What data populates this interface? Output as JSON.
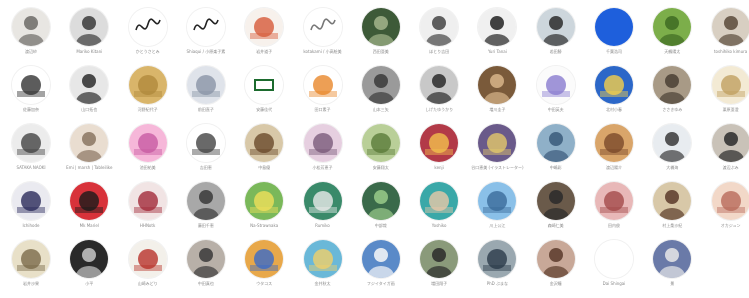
{
  "members": [
    {
      "name": "渡辺紗",
      "fill": "#e8e6e2",
      "accent": "#6c6a66",
      "icon": "portrait-icon"
    },
    {
      "name": "Mariko Kitani",
      "fill": "#dcdcdc",
      "accent": "#3a3a3a",
      "icon": "portrait-icon"
    },
    {
      "name": "かとうさとみ",
      "fill": "#ffffff",
      "accent": "#222222",
      "icon": "signature-icon"
    },
    {
      "name": "Shiaqui / 小原楽子素",
      "fill": "#ffffff",
      "accent": "#222222",
      "icon": "signature-icon"
    },
    {
      "name": "岩井道子",
      "fill": "#f7f1ec",
      "accent": "#d65a3a",
      "icon": "illustration-icon"
    },
    {
      "name": "kotakami / 小高絵美",
      "fill": "#ffffff",
      "accent": "#777777",
      "icon": "signature-icon"
    },
    {
      "name": "西田亜美",
      "fill": "#3d5a38",
      "accent": "#a3b58c",
      "icon": "photo-icon"
    },
    {
      "name": "ほとり吉田",
      "fill": "#efefef",
      "accent": "#444444",
      "icon": "portrait-icon"
    },
    {
      "name": "Yuri Tanai",
      "fill": "#f0f0f0",
      "accent": "#222222",
      "icon": "portrait-icon"
    },
    {
      "name": "若田勝",
      "fill": "#cdd6dc",
      "accent": "#2c2c2c",
      "icon": "portrait-icon"
    },
    {
      "name": "千葉浩司",
      "fill": "#1e5fdc",
      "accent": "#1e5fdc",
      "icon": "color-icon"
    },
    {
      "name": "天鶴陽太",
      "fill": "#7cae4a",
      "accent": "#3e6b22",
      "icon": "photo-icon"
    },
    {
      "name": "toshihiko kimura",
      "fill": "#d8cfc2",
      "accent": "#5a4a3a",
      "icon": "portrait-icon"
    },
    {
      "name": "佐藤加奈",
      "fill": "#ffffff",
      "accent": "#333333",
      "icon": "illustration-icon"
    },
    {
      "name": "山口拓也",
      "fill": "#e7e7e7",
      "accent": "#2c2c2c",
      "icon": "portrait-icon"
    },
    {
      "name": "河野紀代子",
      "fill": "#d9b56a",
      "accent": "#b08a3c",
      "icon": "illustration-icon"
    },
    {
      "name": "前田直子",
      "fill": "#dfe3ea",
      "accent": "#8a94a6",
      "icon": "illustration-icon"
    },
    {
      "name": "安藤佳代",
      "fill": "#ffffff",
      "accent": "#1c6b2e",
      "icon": "logo-icon"
    },
    {
      "name": "田口素子",
      "fill": "#ffffff",
      "accent": "#e8872a",
      "icon": "illustration-icon"
    },
    {
      "name": "山本三矢",
      "fill": "#9a9a9a",
      "accent": "#3a3a3a",
      "icon": "photo-icon"
    },
    {
      "name": "しげたゆうかり",
      "fill": "#c8c8c8",
      "accent": "#2a2a2a",
      "icon": "portrait-icon"
    },
    {
      "name": "増川圭子",
      "fill": "#7a5a3a",
      "accent": "#d8b58a",
      "icon": "photo-icon"
    },
    {
      "name": "中田英夫",
      "fill": "#fbfbfb",
      "accent": "#8a7cd0",
      "icon": "illustration-icon"
    },
    {
      "name": "北村小春",
      "fill": "#2c67c8",
      "accent": "#f5d04a",
      "icon": "illustration-icon"
    },
    {
      "name": "ささきゆみ",
      "fill": "#a89a86",
      "accent": "#4a4034",
      "icon": "photo-icon"
    },
    {
      "name": "栗原亜澄",
      "fill": "#f3ead4",
      "accent": "#c0a060",
      "icon": "illustration-icon"
    },
    {
      "name": "SATAKA NAOKI",
      "fill": "#ececec",
      "accent": "#444444",
      "icon": "illustration-icon"
    },
    {
      "name": "Emi | marsh | Tableilike",
      "fill": "#e9ddd0",
      "accent": "#8a7562",
      "icon": "portrait-icon"
    },
    {
      "name": "池田祐美",
      "fill": "#f6b7d9",
      "accent": "#c85aa2",
      "icon": "illustration-icon"
    },
    {
      "name": "吉田恵",
      "fill": "#ffffff",
      "accent": "#444444",
      "icon": "illustration-icon"
    },
    {
      "name": "中島優",
      "fill": "#d8c8a8",
      "accent": "#6a4a2a",
      "icon": "illustration-icon"
    },
    {
      "name": "小松芳恵子",
      "fill": "#e6cfe0",
      "accent": "#7a5a7a",
      "icon": "illustration-icon"
    },
    {
      "name": "安藤翔太",
      "fill": "#b9cf98",
      "accent": "#5a7a3a",
      "icon": "illustration-icon"
    },
    {
      "name": "kenji",
      "fill": "#b23a48",
      "accent": "#f2c14e",
      "icon": "illustration-icon"
    },
    {
      "name": "谷口恵美 (イラストレーター)",
      "fill": "#6a5a8a",
      "accent": "#e3c86a",
      "icon": "illustration-icon"
    },
    {
      "name": "中嶋彩",
      "fill": "#8fb0c8",
      "accent": "#3a5a7a",
      "icon": "photo-icon"
    },
    {
      "name": "渡辺陽介",
      "fill": "#d9a56a",
      "accent": "#7a4a2a",
      "icon": "illustration-icon"
    },
    {
      "name": "大橋海",
      "fill": "#e8ecf0",
      "accent": "#3a3a3a",
      "icon": "portrait-icon"
    },
    {
      "name": "渡辺ぶみ",
      "fill": "#c9c2b8",
      "accent": "#2a2a2a",
      "icon": "portrait-icon"
    },
    {
      "name": "Ichihode",
      "fill": "#eaeaf0",
      "accent": "#2a2a5a",
      "icon": "illustration-icon"
    },
    {
      "name": "Mk Mariel",
      "fill": "#d8323a",
      "accent": "#1a1a1a",
      "icon": "illustration-icon"
    },
    {
      "name": "HHNotk",
      "fill": "#f1e4e4",
      "accent": "#a22a3a",
      "icon": "illustration-icon"
    },
    {
      "name": "藤田千恵",
      "fill": "#a8a8a8",
      "accent": "#3a3a3a",
      "icon": "photo-icon"
    },
    {
      "name": "Na-Strawnaka",
      "fill": "#7ab85a",
      "accent": "#f0e05a",
      "icon": "illustration-icon"
    },
    {
      "name": "Rumiko",
      "fill": "#3a8a6a",
      "accent": "#eaeaea",
      "icon": "illustration-icon"
    },
    {
      "name": "中部哉",
      "fill": "#3a6a4a",
      "accent": "#9acb8a",
      "icon": "photo-icon"
    },
    {
      "name": "Yoshiko",
      "fill": "#3aa8a8",
      "accent": "#e8c8a8",
      "icon": "illustration-icon"
    },
    {
      "name": "川上公江",
      "fill": "#8ac0e8",
      "accent": "#3a6a9a",
      "icon": "illustration-icon"
    },
    {
      "name": "森崎仁美",
      "fill": "#6a5a4a",
      "accent": "#2a2a2a",
      "icon": "photo-icon"
    },
    {
      "name": "田内俊",
      "fill": "#e8b8b8",
      "accent": "#a24a4a",
      "icon": "illustration-icon"
    },
    {
      "name": "村上桑沙紀",
      "fill": "#d8c8a8",
      "accent": "#5a3a2a",
      "icon": "portrait-icon"
    },
    {
      "name": "オカジュン",
      "fill": "#f2d8c8",
      "accent": "#b86a5a",
      "icon": "illustration-icon"
    },
    {
      "name": "岩井沙果",
      "fill": "#e8e0c8",
      "accent": "#7a6a4a",
      "icon": "illustration-icon"
    },
    {
      "name": "小平",
      "fill": "#2a2a2a",
      "accent": "#c8c8c8",
      "icon": "photo-icon"
    },
    {
      "name": "山崎みどり",
      "fill": "#f3f0ea",
      "accent": "#b8322a",
      "icon": "illustration-icon"
    },
    {
      "name": "中田真也",
      "fill": "#b8b0a8",
      "accent": "#3a3a3a",
      "icon": "portrait-icon"
    },
    {
      "name": "ウタコス",
      "fill": "#e8a84a",
      "accent": "#3a6ac8",
      "icon": "illustration-icon"
    },
    {
      "name": "金井秋太",
      "fill": "#6ab8d8",
      "accent": "#f0d06a",
      "icon": "illustration-icon"
    },
    {
      "name": "フジイタイガ画",
      "fill": "#5a8ac8",
      "accent": "#f8f8f8",
      "icon": "photo-icon"
    },
    {
      "name": "増田翔子",
      "fill": "#8a9a7a",
      "accent": "#2a2a2a",
      "icon": "portrait-icon"
    },
    {
      "name": "PhD ぶまな",
      "fill": "#9aa8b0",
      "accent": "#2a3a4a",
      "icon": "illustration-icon"
    },
    {
      "name": "金沢瞳",
      "fill": "#c8a898",
      "accent": "#5a3a2a",
      "icon": "portrait-icon"
    },
    {
      "name": "Dai Shingai",
      "fill": "#ffffff",
      "accent": "#aaaaaa",
      "icon": "blank-icon"
    },
    {
      "name": "景",
      "fill": "#6a7aa8",
      "accent": "#e8e8e8",
      "icon": "photo-icon"
    }
  ]
}
